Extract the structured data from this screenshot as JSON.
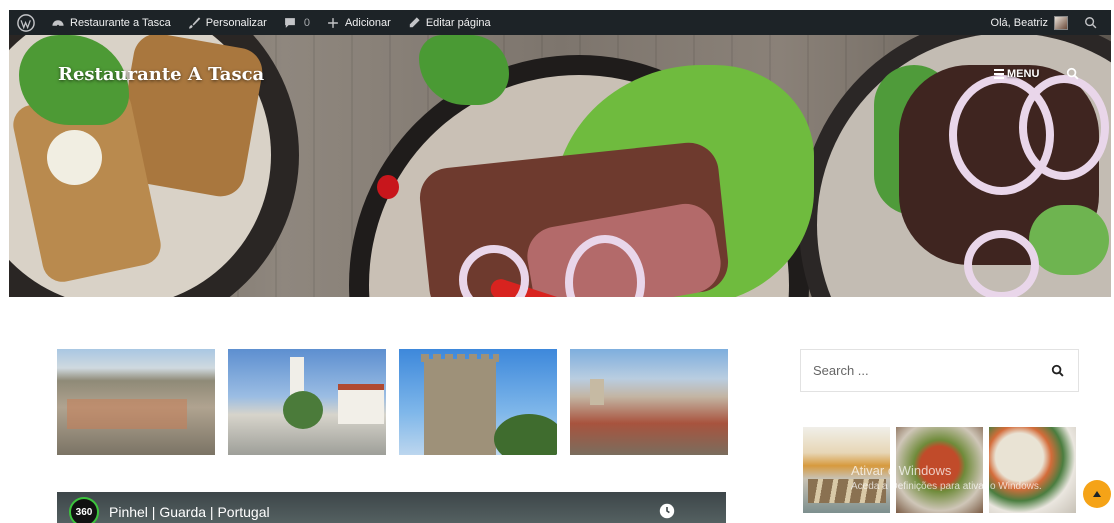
{
  "admin_bar": {
    "wp_icon": "wordpress-logo-icon",
    "site_name": "Restaurante a Tasca",
    "customize": "Personalizar",
    "comments_count": "0",
    "add_new": "Adicionar",
    "edit_page": "Editar página",
    "greeting": "Olá, Beatriz"
  },
  "header": {
    "site_title": "Restaurante A Tasca",
    "menu_label": "MENU",
    "menu_icon": "hamburger-icon",
    "search_icon": "search-icon"
  },
  "gallery": {
    "images": [
      {
        "name": "gallery-image-town-aerial"
      },
      {
        "name": "gallery-image-town-square"
      },
      {
        "name": "gallery-image-castle-tower"
      },
      {
        "name": "gallery-image-rooftops"
      }
    ]
  },
  "video": {
    "badge": "360",
    "title": "Pinhel | Guarda | Portugal",
    "watch_later_icon": "clock-icon",
    "share_icon": "share-icon"
  },
  "sidebar": {
    "search_placeholder": "Search ...",
    "search_icon": "search-icon",
    "food_thumbs": [
      "sidebar-thumb-sardines",
      "sidebar-thumb-stew",
      "sidebar-thumb-salad"
    ]
  },
  "overlay": {
    "watermark_line1": "Ativar o Windows",
    "watermark_line2": "Aceda a Definições para ativar o Windows."
  },
  "colors": {
    "admin_bar_bg": "#1d2327",
    "scroll_top_accent": "#f5a317"
  }
}
